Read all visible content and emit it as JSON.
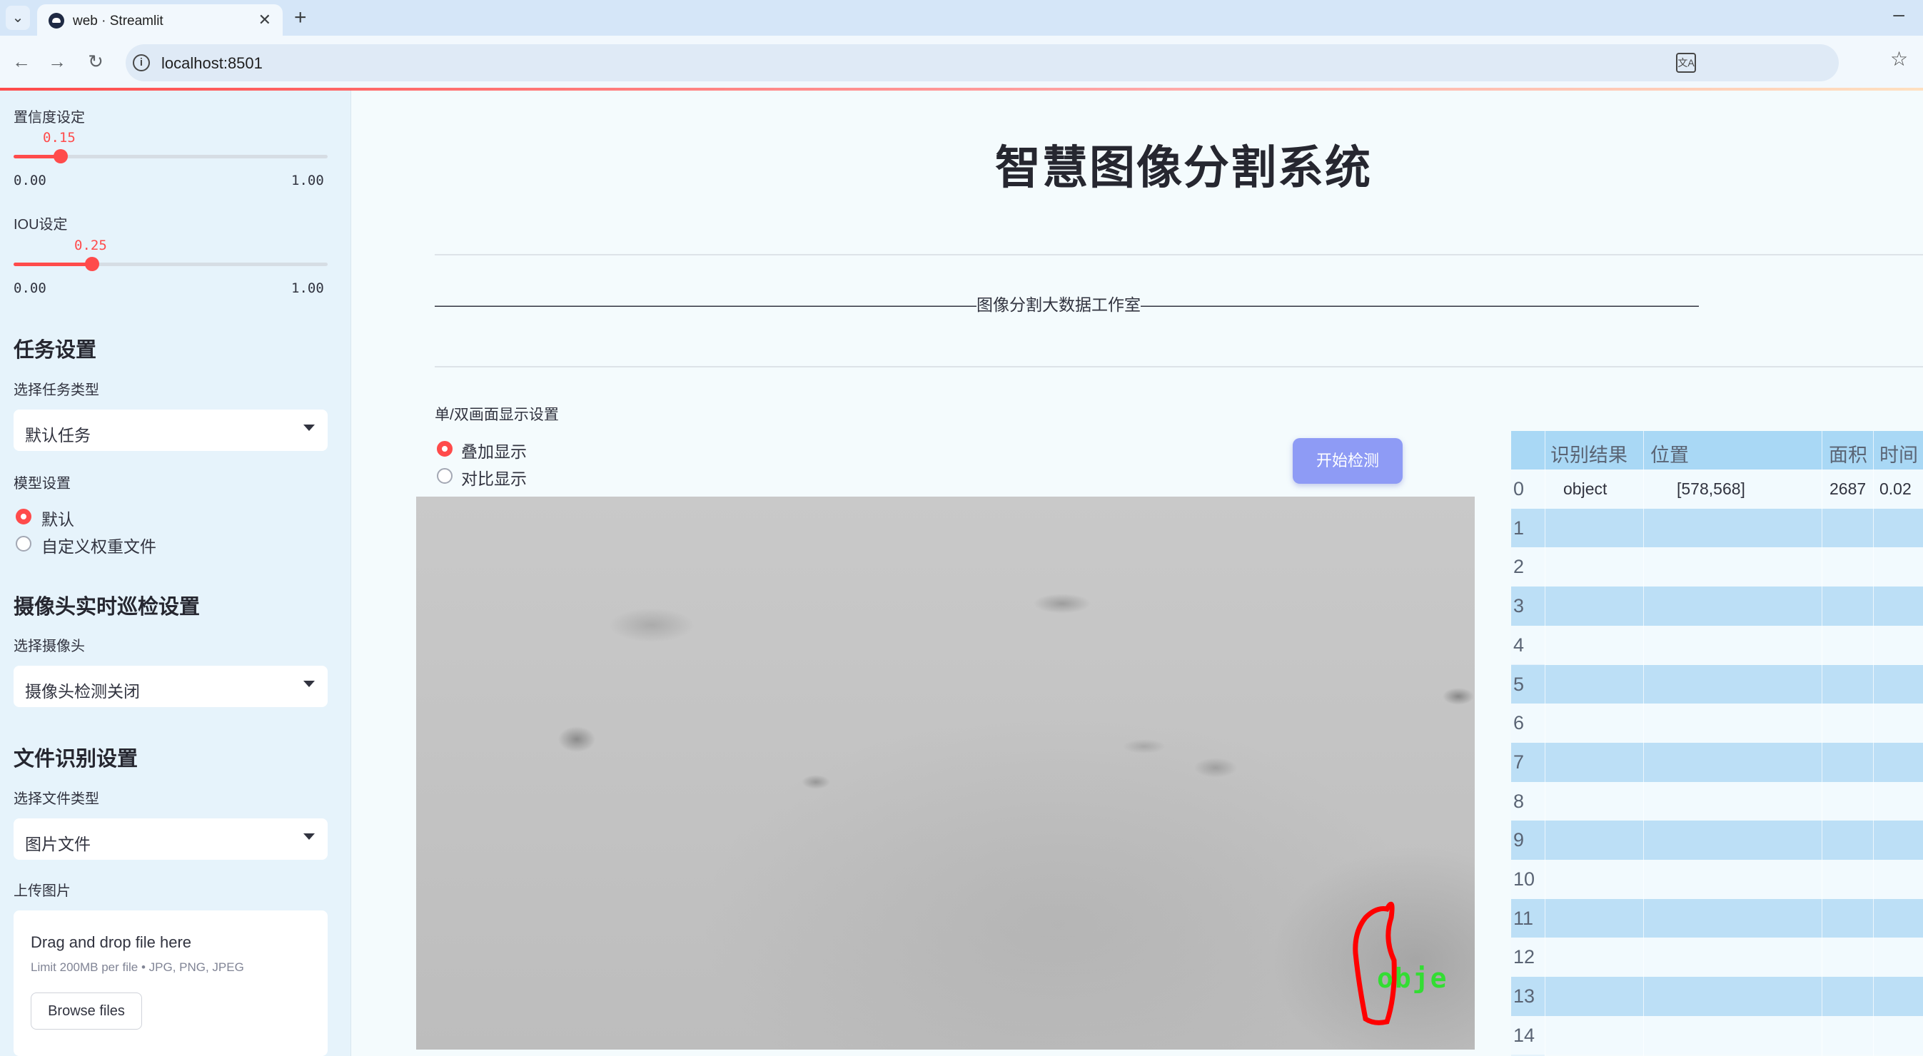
{
  "browser": {
    "tab_title": "web · Streamlit",
    "url": "localhost:8501"
  },
  "sidebar": {
    "confidence": {
      "label": "置信度设定",
      "value": "0.15",
      "min": "0.00",
      "max": "1.00",
      "fraction": 0.15
    },
    "iou": {
      "label": "IOU设定",
      "value": "0.25",
      "min": "0.00",
      "max": "1.00",
      "fraction": 0.25
    },
    "task_header": "任务设置",
    "task_type_label": "选择任务类型",
    "task_type_value": "默认任务",
    "model_label": "模型设置",
    "model_options": [
      {
        "label": "默认",
        "selected": true
      },
      {
        "label": "自定义权重文件",
        "selected": false
      }
    ],
    "camera_header": "摄像头实时巡检设置",
    "camera_label": "选择摄像头",
    "camera_value": "摄像头检测关闭",
    "file_header": "文件识别设置",
    "file_type_label": "选择文件类型",
    "file_type_value": "图片文件",
    "upload_label": "上传图片",
    "upload_title": "Drag and drop file here",
    "upload_sub": "Limit 200MB per file • JPG, PNG, JPEG",
    "browse_label": "Browse files"
  },
  "main": {
    "title": "智慧图像分割系统",
    "banner": "—————————————————————————————————图像分割大数据工作室——————————————————————————————————",
    "display_label": "单/双画面显示设置",
    "display_options": [
      {
        "label": "叠加显示",
        "selected": true
      },
      {
        "label": "对比显示",
        "selected": false
      }
    ],
    "start_button": "开始检测",
    "detection_label": "obje",
    "accent_color": "#ff4b4b",
    "button_color": "#8e9bf5"
  },
  "results_table": {
    "headers": [
      "识别结果",
      "位置",
      "面积",
      "时间"
    ],
    "rows": [
      {
        "index": "0",
        "result": "object",
        "position": "[578,568]",
        "area": "2687",
        "time": "0.02"
      },
      {
        "index": "1"
      },
      {
        "index": "2"
      },
      {
        "index": "3"
      },
      {
        "index": "4"
      },
      {
        "index": "5"
      },
      {
        "index": "6"
      },
      {
        "index": "7"
      },
      {
        "index": "8"
      },
      {
        "index": "9"
      },
      {
        "index": "10"
      },
      {
        "index": "11"
      },
      {
        "index": "12"
      },
      {
        "index": "13"
      },
      {
        "index": "14"
      }
    ]
  }
}
